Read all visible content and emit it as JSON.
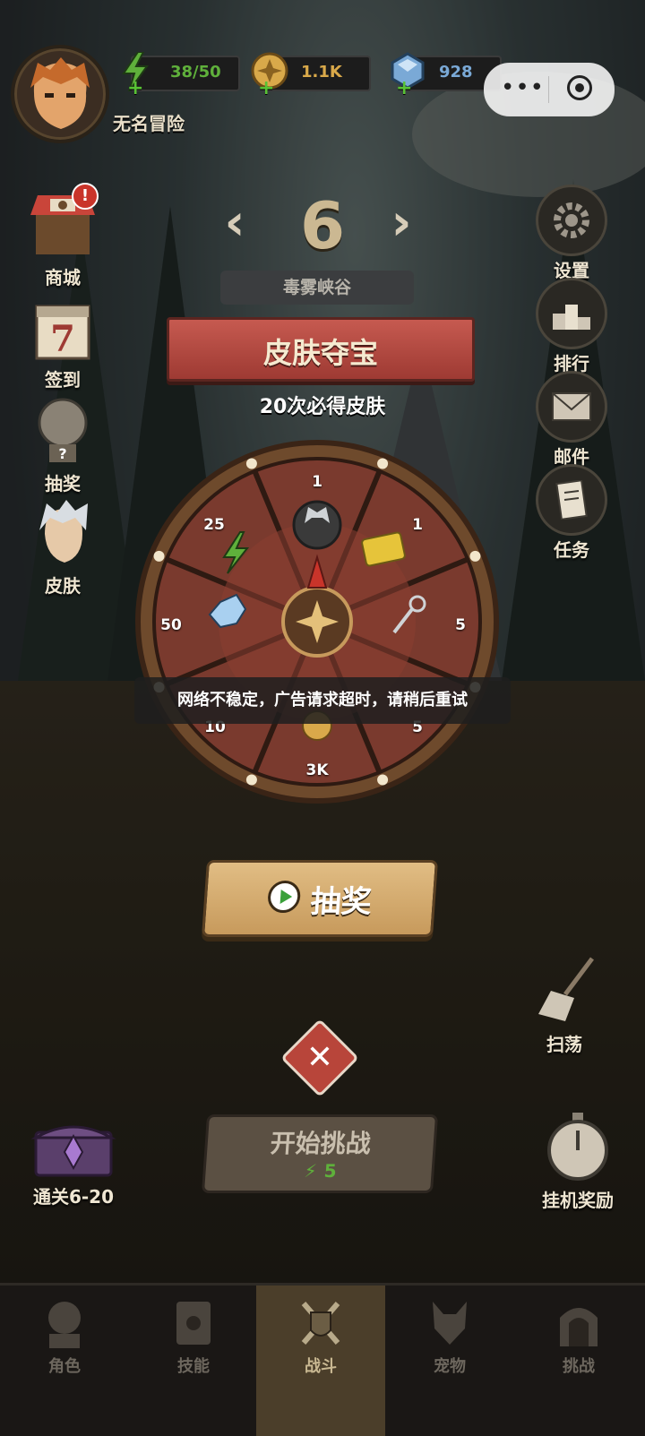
{
  "player": {
    "name": "无名冒险"
  },
  "resources": [
    {
      "id": "energy",
      "value": "38/50",
      "color": "#5fb03b",
      "icon": "lightning-icon"
    },
    {
      "id": "gold",
      "value": "1.1K",
      "color": "#d9a94a",
      "icon": "coin-icon"
    },
    {
      "id": "gems",
      "value": "928",
      "color": "#7aa9d6",
      "icon": "gem-icon"
    }
  ],
  "left_menu": [
    {
      "label": "商城",
      "icon": "shop-icon",
      "badge": "!"
    },
    {
      "label": "签到",
      "icon": "calendar-icon",
      "day": "7"
    },
    {
      "label": "抽奖",
      "icon": "lottery-icon"
    },
    {
      "label": "皮肤",
      "icon": "skin-icon"
    }
  ],
  "right_menu": [
    {
      "label": "设置",
      "icon": "gear-icon"
    },
    {
      "label": "排行",
      "icon": "podium-icon"
    },
    {
      "label": "邮件",
      "icon": "mail-icon"
    },
    {
      "label": "任务",
      "icon": "quest-icon"
    }
  ],
  "stage": {
    "number": "6",
    "name": "毒雾峡谷"
  },
  "popup": {
    "title": "皮肤夺宝",
    "subtitle": "20次必得皮肤",
    "wheel_segments": [
      "1",
      "1",
      "5",
      "5",
      "3K",
      "10",
      "50",
      "25"
    ],
    "spin_label": "抽奖",
    "toast": "网络不稳定，广告请求超时，请稍后重试"
  },
  "sweep": {
    "label": "扫荡"
  },
  "chest": {
    "label": "通关6-20"
  },
  "challenge": {
    "label": "开始挑战",
    "cost": "5"
  },
  "idle": {
    "label": "挂机奖励"
  },
  "nav": [
    {
      "label": "角色",
      "active": false
    },
    {
      "label": "技能",
      "active": false
    },
    {
      "label": "战斗",
      "active": true
    },
    {
      "label": "宠物",
      "active": false
    },
    {
      "label": "挑战",
      "active": false
    }
  ]
}
